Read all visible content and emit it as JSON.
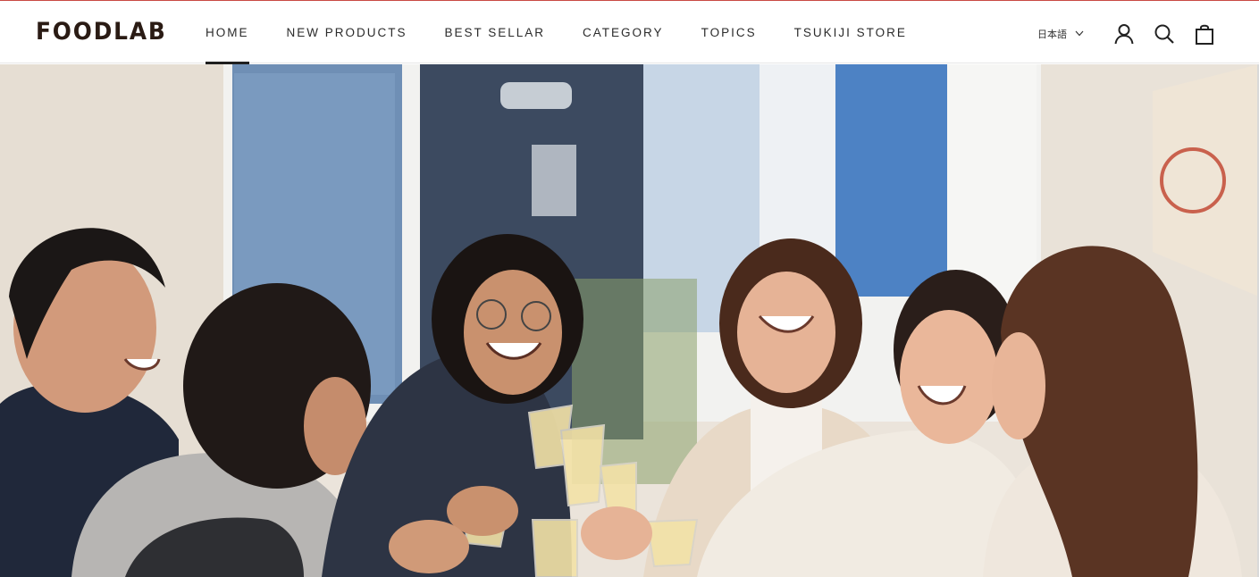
{
  "brand": {
    "logo_text": "FOODLAB"
  },
  "nav": {
    "items": [
      {
        "label": "HOME",
        "active": true
      },
      {
        "label": "NEW PRODUCTS",
        "active": false
      },
      {
        "label": "BEST SELLAR",
        "active": false
      },
      {
        "label": "CATEGORY",
        "active": false
      },
      {
        "label": "TOPICS",
        "active": false
      },
      {
        "label": "TSUKIJI STORE",
        "active": false
      }
    ]
  },
  "header": {
    "language_label": "日本語",
    "icons": [
      "chevron-down-icon",
      "account-icon",
      "search-icon",
      "cart-icon"
    ]
  },
  "colors": {
    "accent_line": "#c94a44",
    "logo": "#2a1b14",
    "text": "#2b2b2b"
  }
}
